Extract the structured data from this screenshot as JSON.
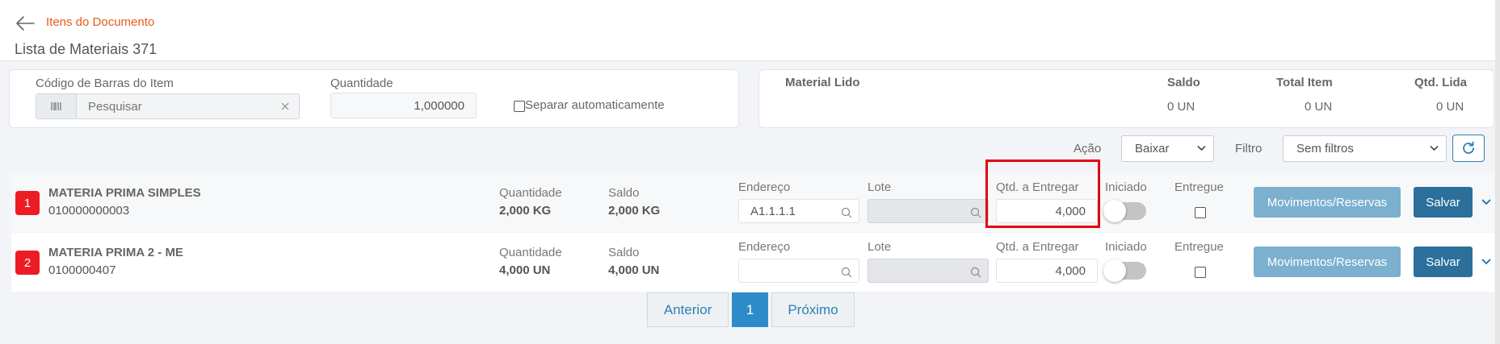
{
  "header": {
    "back_icon": "arrow-left-icon",
    "breadcrumb": "Itens do Documento",
    "title": "Lista de Materiais 371"
  },
  "scan": {
    "barcode_label": "Código de Barras do Item",
    "barcode_icon": "barcode-icon",
    "barcode_placeholder": "Pesquisar",
    "quantity_label": "Quantidade",
    "quantity_value": "1,000000",
    "auto_separate_label": "Separar automaticamente",
    "auto_separate_checked": false
  },
  "summary": {
    "material_label": "Material Lido",
    "saldo_label": "Saldo",
    "saldo_value": "0 UN",
    "total_label": "Total Item",
    "total_value": "0 UN",
    "lida_label": "Qtd. Lida",
    "lida_value": "0 UN"
  },
  "filters": {
    "acao_label": "Ação",
    "acao_value": "Baixar",
    "filtro_label": "Filtro",
    "filtro_value": "Sem filtros",
    "refresh_icon": "refresh-icon"
  },
  "items": [
    {
      "index": "1",
      "name": "MATERIA PRIMA SIMPLES",
      "code": "010000000003",
      "quantidade_label": "Quantidade",
      "quantidade": "2,000 KG",
      "saldo_label": "Saldo",
      "saldo": "2,000 KG",
      "endereco_label": "Endereço",
      "endereco": "A1.1.1.1",
      "lote_label": "Lote",
      "lote": "",
      "qtd_entregar_label": "Qtd. a Entregar",
      "qtd_entregar": "4,000",
      "iniciado_label": "Iniciado",
      "iniciado": false,
      "entregue_label": "Entregue",
      "entregue": false,
      "movimentos_label": "Movimentos/Reservas",
      "salvar_label": "Salvar"
    },
    {
      "index": "2",
      "name": "MATERIA PRIMA 2 - ME",
      "code": "0100000407",
      "quantidade_label": "Quantidade",
      "quantidade": "4,000 UN",
      "saldo_label": "Saldo",
      "saldo": "4,000 UN",
      "endereco_label": "Endereço",
      "endereco": "",
      "lote_label": "Lote",
      "lote": "",
      "qtd_entregar_label": "Qtd. a Entregar",
      "qtd_entregar": "4,000",
      "iniciado_label": "Iniciado",
      "iniciado": false,
      "entregue_label": "Entregue",
      "entregue": false,
      "movimentos_label": "Movimentos/Reservas",
      "salvar_label": "Salvar"
    }
  ],
  "pagination": {
    "prev_label": "Anterior",
    "current_page": "1",
    "next_label": "Próximo"
  },
  "colors": {
    "accent": "#e8591a",
    "primary": "#2b6f9a",
    "secondary_button": "#7bb0cf",
    "badge": "#ed1c24",
    "highlight": "#e3000f"
  }
}
